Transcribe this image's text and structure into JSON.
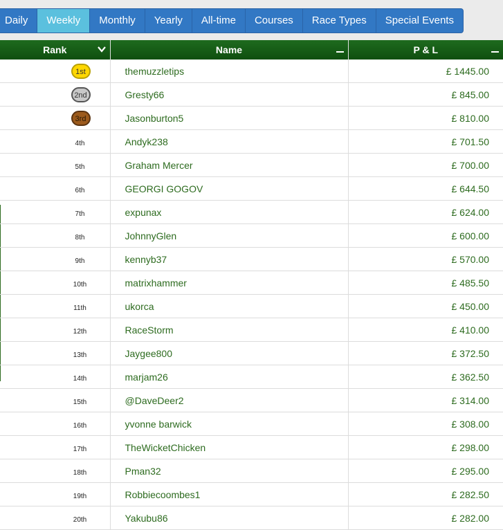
{
  "tabs": [
    {
      "label": "Daily",
      "active": false
    },
    {
      "label": "Weekly",
      "active": true
    },
    {
      "label": "Monthly",
      "active": false
    },
    {
      "label": "Yearly",
      "active": false
    },
    {
      "label": "All-time",
      "active": false
    },
    {
      "label": "Courses",
      "active": false
    },
    {
      "label": "Race Types",
      "active": false
    },
    {
      "label": "Special Events",
      "active": false
    }
  ],
  "table": {
    "headers": {
      "rank": "Rank",
      "name": "Name",
      "pl": "P & L"
    },
    "rows": [
      {
        "rank": "1st",
        "name": "themuzzletips",
        "pl": "£ 1445.00"
      },
      {
        "rank": "2nd",
        "name": "Gresty66",
        "pl": "£ 845.00"
      },
      {
        "rank": "3rd",
        "name": "Jasonburton5",
        "pl": "£ 810.00"
      },
      {
        "rank": "4th",
        "name": "Andyk238",
        "pl": "£ 701.50"
      },
      {
        "rank": "5th",
        "name": "Graham Mercer",
        "pl": "£ 700.00"
      },
      {
        "rank": "6th",
        "name": "GEORGI GOGOV",
        "pl": "£ 644.50"
      },
      {
        "rank": "7th",
        "name": "expunax",
        "pl": "£ 624.00"
      },
      {
        "rank": "8th",
        "name": "JohnnyGlen",
        "pl": "£ 600.00"
      },
      {
        "rank": "9th",
        "name": "kennyb37",
        "pl": "£ 570.00"
      },
      {
        "rank": "10th",
        "name": "matrixhammer",
        "pl": "£ 485.50"
      },
      {
        "rank": "11th",
        "name": "ukorca",
        "pl": "£ 450.00"
      },
      {
        "rank": "12th",
        "name": "RaceStorm",
        "pl": "£ 410.00"
      },
      {
        "rank": "13th",
        "name": "Jaygee800",
        "pl": "£ 372.50"
      },
      {
        "rank": "14th",
        "name": "marjam26",
        "pl": "£ 362.50"
      },
      {
        "rank": "15th",
        "name": "@DaveDeer2",
        "pl": "£ 314.00"
      },
      {
        "rank": "16th",
        "name": "yvonne barwick",
        "pl": "£ 308.00"
      },
      {
        "rank": "17th",
        "name": "TheWicketChicken",
        "pl": "£ 298.00"
      },
      {
        "rank": "18th",
        "name": "Pman32",
        "pl": "£ 295.00"
      },
      {
        "rank": "19th",
        "name": "Robbiecoombes1",
        "pl": "£ 282.50"
      },
      {
        "rank": "20th",
        "name": "Yakubu86",
        "pl": "£ 282.00"
      }
    ]
  },
  "colors": {
    "header_green": "#1e6b1e",
    "text_green": "#2d6b1f",
    "tab_blue": "#3278c4",
    "tab_active": "#5bc0de",
    "gold": "#ffd700",
    "silver": "#c8c8c8",
    "bronze": "#9c5a1c"
  },
  "icons": {
    "rank_sort": "chevron-down-icon",
    "name_collapse": "minus-icon",
    "pl_collapse": "minus-icon"
  }
}
